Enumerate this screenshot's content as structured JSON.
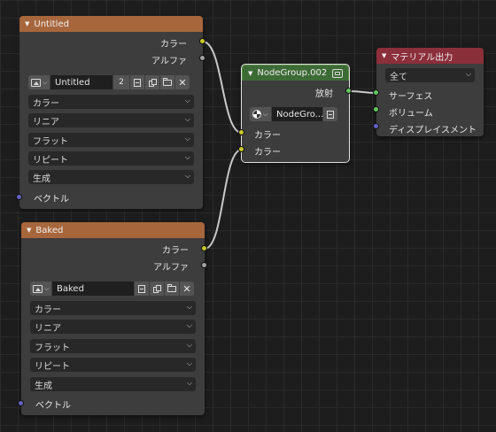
{
  "nodes": {
    "tex_untitled": {
      "title": "Untitled",
      "outputs": [
        "カラー",
        "アルファ"
      ],
      "image_name": "Untitled",
      "users_count": "2",
      "dropdowns": [
        "カラー",
        "リニア",
        "フラット",
        "リピート",
        "生成"
      ],
      "input_vector": "ベクトル"
    },
    "tex_baked": {
      "title": "Baked",
      "outputs": [
        "カラー",
        "アルファ"
      ],
      "image_name": "Baked",
      "dropdowns": [
        "カラー",
        "リニア",
        "フラット",
        "リピート",
        "生成"
      ],
      "input_vector": "ベクトル"
    },
    "node_group": {
      "title": "NodeGroup.002",
      "output": "放射",
      "group_name": "NodeGro...",
      "inputs": [
        "カラー",
        "カラー"
      ]
    },
    "material_output": {
      "title": "マテリアル出力",
      "target": "全て",
      "inputs": [
        "サーフェス",
        "ボリューム",
        "ディスプレイスメント"
      ]
    }
  },
  "socket_colors": {
    "color": "#c7c729",
    "float": "#a1a1a1",
    "shader": "#63c763",
    "vector": "#6363c7"
  },
  "header_colors": {
    "texture": "#a8663c",
    "group": "#3d6b35",
    "output": "#8b2f3a"
  }
}
